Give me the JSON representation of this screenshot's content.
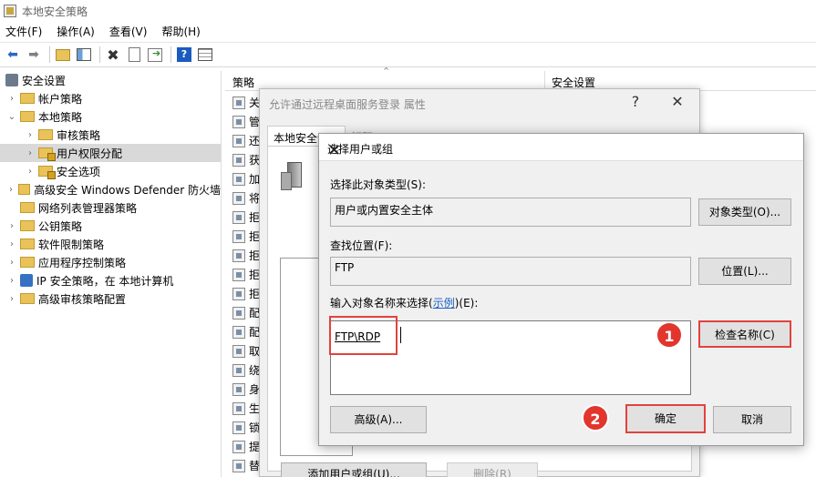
{
  "window": {
    "title": "本地安全策略"
  },
  "menu": [
    "文件(F)",
    "操作(A)",
    "查看(V)",
    "帮助(H)"
  ],
  "toolbar": {
    "icons": [
      "back-icon",
      "forward-icon",
      "up-folder-icon",
      "show-hide-tree-icon",
      "delete-icon",
      "properties-icon",
      "export-icon",
      "help-icon",
      "grid-icon"
    ],
    "help_glyph": "?"
  },
  "tree": {
    "root": "安全设置",
    "items": [
      {
        "label": "帐户策略",
        "level": 1,
        "chevron": "›"
      },
      {
        "label": "本地策略",
        "level": 1,
        "chevron": "⌄"
      },
      {
        "label": "审核策略",
        "level": 2,
        "chevron": "›"
      },
      {
        "label": "用户权限分配",
        "level": 2,
        "chevron": "›",
        "selected": true
      },
      {
        "label": "安全选项",
        "level": 2,
        "chevron": "›"
      },
      {
        "label": "高级安全 Windows Defender 防火墙",
        "level": 1,
        "chevron": "›"
      },
      {
        "label": "网络列表管理器策略",
        "level": 1,
        "chevron": ""
      },
      {
        "label": "公钥策略",
        "level": 1,
        "chevron": "›"
      },
      {
        "label": "软件限制策略",
        "level": 1,
        "chevron": "›"
      },
      {
        "label": "应用程序控制策略",
        "level": 1,
        "chevron": "›"
      },
      {
        "label": "IP 安全策略，在 本地计算机",
        "level": 1,
        "chevron": "›"
      },
      {
        "label": "高级审核策略配置",
        "level": 1,
        "chevron": "›"
      }
    ]
  },
  "list": {
    "col_policy": "策略",
    "col_setting": "安全设置",
    "rows": [
      "关",
      "管",
      "还",
      "获",
      "加",
      "将",
      "拒",
      "拒",
      "拒",
      "拒",
      "拒",
      "配",
      "配",
      "取",
      "绕",
      "身",
      "生",
      "锁",
      "提",
      "替"
    ]
  },
  "props_dialog": {
    "title": "允许通过远程桌面服务登录 属性",
    "help": "?",
    "close": "✕",
    "tab1": "本地安全设置",
    "tab2": "解释",
    "add_button": "添加用户或组(U)...",
    "remove_button": "删除(R)"
  },
  "select_dialog": {
    "title": "选择用户或组",
    "close": "✕",
    "object_type_label": "选择此对象类型(S):",
    "object_type_value": "用户或内置安全主体",
    "object_type_button": "对象类型(O)...",
    "location_label": "查找位置(F):",
    "location_value": "FTP",
    "location_button": "位置(L)...",
    "names_label_prefix": "输入对象名称来选择(",
    "names_label_link": "示例",
    "names_label_suffix": ")(E):",
    "names_value": "FTP\\RDP",
    "check_names_button": "检查名称(C)",
    "advanced_button": "高级(A)...",
    "ok_button": "确定",
    "cancel_button": "取消"
  },
  "annotations": {
    "step1": "1",
    "step2": "2",
    "color": "#e2352e"
  }
}
